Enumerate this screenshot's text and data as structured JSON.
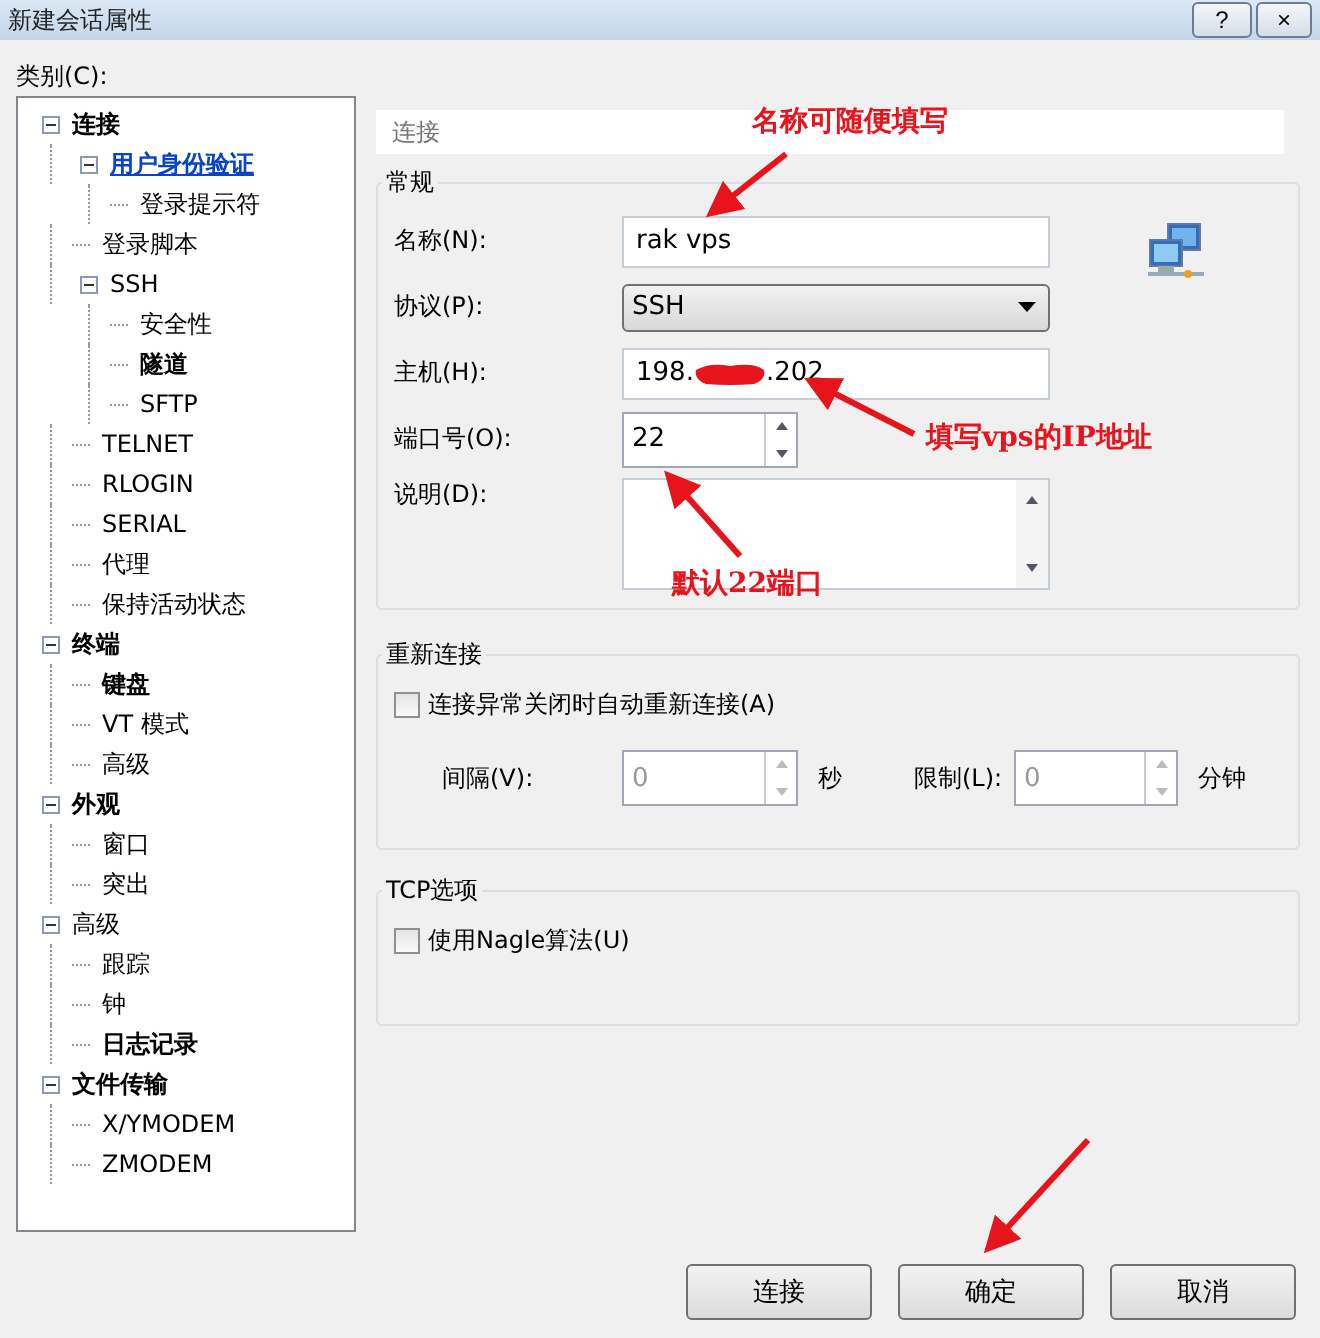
{
  "window": {
    "title": "新建会话属性",
    "buttons": [
      "?",
      "×"
    ]
  },
  "category_label": "类别(C):",
  "tree": [
    {
      "label": "连接",
      "bold": true,
      "selected": false,
      "expanded": true,
      "children": [
        {
          "label": "用户身份验证",
          "bold": false,
          "selected": true,
          "expanded": true,
          "children": [
            {
              "label": "登录提示符",
              "bold": false,
              "selected": false
            }
          ]
        },
        {
          "label": "登录脚本",
          "bold": false,
          "selected": false
        },
        {
          "label": "SSH",
          "bold": false,
          "selected": false,
          "expanded": true,
          "children": [
            {
              "label": "安全性",
              "bold": false,
              "selected": false
            },
            {
              "label": "隧道",
              "bold": true,
              "selected": false
            },
            {
              "label": "SFTP",
              "bold": false,
              "selected": false
            }
          ]
        },
        {
          "label": "TELNET",
          "bold": false,
          "selected": false
        },
        {
          "label": "RLOGIN",
          "bold": false,
          "selected": false
        },
        {
          "label": "SERIAL",
          "bold": false,
          "selected": false
        },
        {
          "label": "代理",
          "bold": false,
          "selected": false
        },
        {
          "label": "保持活动状态",
          "bold": false,
          "selected": false
        }
      ]
    },
    {
      "label": "终端",
      "bold": true,
      "selected": false,
      "expanded": true,
      "children": [
        {
          "label": "键盘",
          "bold": true,
          "selected": false
        },
        {
          "label": "VT 模式",
          "bold": false,
          "selected": false
        },
        {
          "label": "高级",
          "bold": false,
          "selected": false
        }
      ]
    },
    {
      "label": "外观",
      "bold": true,
      "selected": false,
      "expanded": true,
      "children": [
        {
          "label": "窗口",
          "bold": false,
          "selected": false
        },
        {
          "label": "突出",
          "bold": false,
          "selected": false
        }
      ]
    },
    {
      "label": "高级",
      "bold": false,
      "selected": false,
      "expanded": true,
      "children": [
        {
          "label": "跟踪",
          "bold": false,
          "selected": false
        },
        {
          "label": "钟",
          "bold": false,
          "selected": false
        },
        {
          "label": "日志记录",
          "bold": true,
          "selected": false
        }
      ]
    },
    {
      "label": "文件传输",
      "bold": true,
      "selected": false,
      "expanded": true,
      "children": [
        {
          "label": "X/YMODEM",
          "bold": false,
          "selected": false
        },
        {
          "label": "ZMODEM",
          "bold": false,
          "selected": false
        }
      ]
    }
  ],
  "section_title": "连接",
  "general": {
    "title": "常规",
    "name": {
      "label": "名称(N):",
      "value": "rak vps"
    },
    "protocol": {
      "label": "协议(P):",
      "value": "SSH"
    },
    "host": {
      "label": "主机(H):",
      "value_parts": [
        "198.",
        ".202"
      ]
    },
    "port": {
      "label": "端口号(O):",
      "value": "22"
    },
    "description": {
      "label": "说明(D):"
    }
  },
  "reconnect": {
    "title": "重新连接",
    "auto": {
      "label": "连接异常关闭时自动重新连接(A)",
      "checked": false
    },
    "interval": {
      "label": "间隔(V):",
      "value": "0",
      "unit": "秒",
      "disabled": true
    },
    "limit": {
      "label": "限制(L):",
      "value": "0",
      "unit": "分钟",
      "disabled": true
    }
  },
  "tcp": {
    "title": "TCP选项",
    "nagle": {
      "label": "使用Nagle算法(U)",
      "checked": false
    }
  },
  "buttons": [
    "连接",
    "确定",
    "取消"
  ],
  "annotations": [
    "名称可随便填写",
    "填写vps的IP地址",
    "默认22端口"
  ]
}
